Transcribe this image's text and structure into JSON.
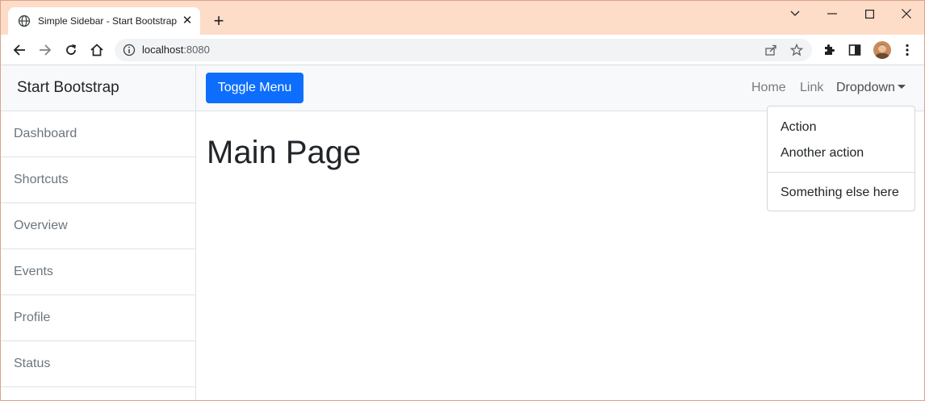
{
  "browser": {
    "tab_title": "Simple Sidebar - Start Bootstrap",
    "new_tab": "+",
    "url_host": "localhost",
    "url_port": ":8080"
  },
  "sidebar": {
    "heading": "Start Bootstrap",
    "items": [
      {
        "label": "Dashboard"
      },
      {
        "label": "Shortcuts"
      },
      {
        "label": "Overview"
      },
      {
        "label": "Events"
      },
      {
        "label": "Profile"
      },
      {
        "label": "Status"
      }
    ]
  },
  "navbar": {
    "toggle_label": "Toggle Menu",
    "links": {
      "home": "Home",
      "link": "Link",
      "dropdown": "Dropdown"
    }
  },
  "dropdown_menu": {
    "items": [
      "Action",
      "Another action",
      "Something else here"
    ]
  },
  "main": {
    "title": "Main Page"
  },
  "colors": {
    "titlebar": "#fddcc8",
    "primary": "#0d6efd"
  }
}
